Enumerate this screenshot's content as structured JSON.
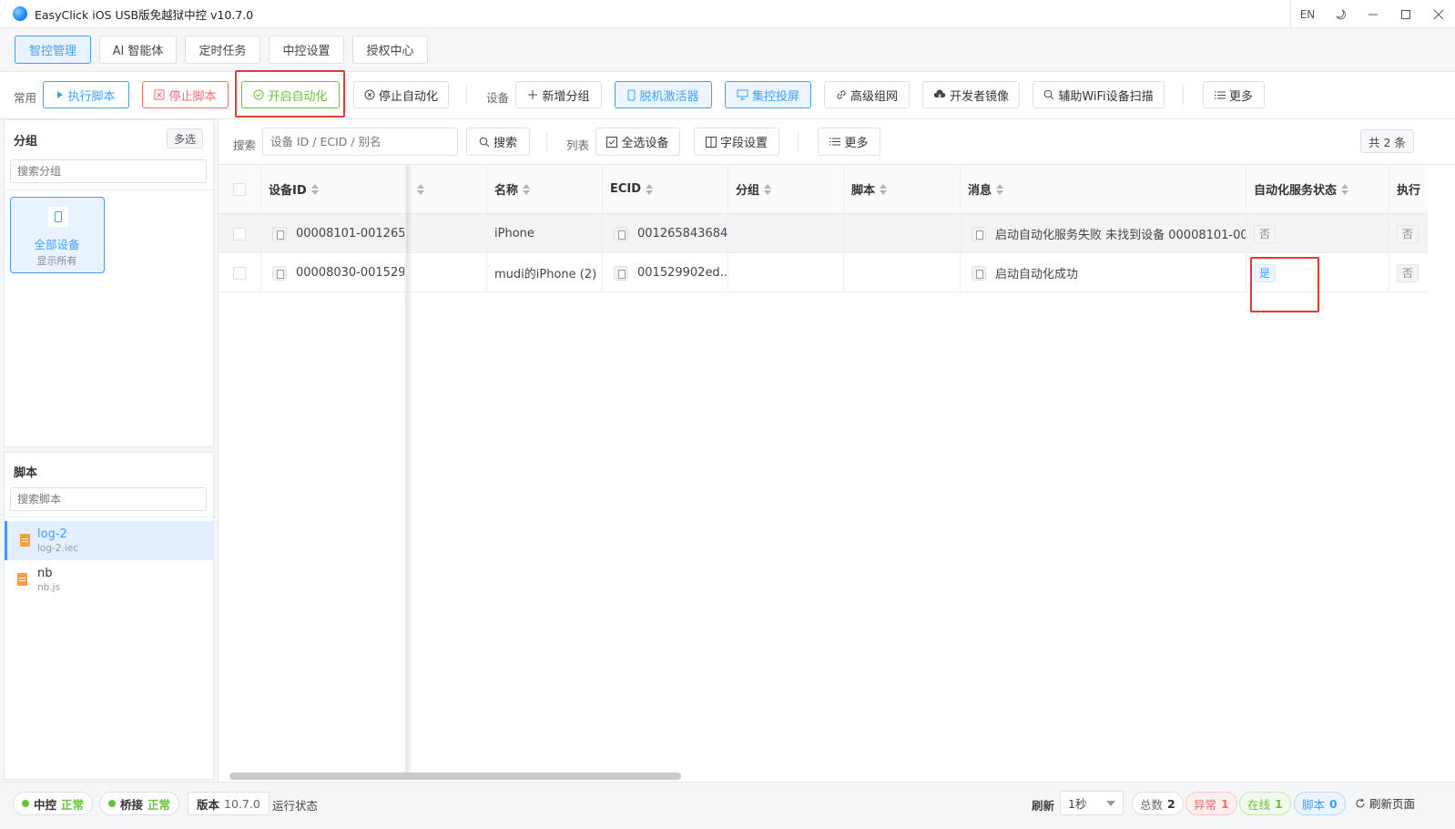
{
  "window": {
    "title": "EasyClick iOS USB版免越狱中控 v10.7.0",
    "lang_button": "EN"
  },
  "top_tabs": [
    {
      "label": "智控管理",
      "active": true
    },
    {
      "label": "AI 智能体",
      "active": false
    },
    {
      "label": "定时任务",
      "active": false
    },
    {
      "label": "中控设置",
      "active": false
    },
    {
      "label": "授权中心",
      "active": false
    }
  ],
  "toolbar": {
    "common_label": "常用",
    "run_script": "执行脚本",
    "stop_script": "停止脚本",
    "start_automation": "开启自动化",
    "stop_automation": "停止自动化",
    "device_label": "设备",
    "add_group": "新增分组",
    "offline_activator": "脱机激活器",
    "group_screen": "集控投屏",
    "advanced_network": "高级组网",
    "developer_image": "开发者镜像",
    "wifi_scan": "辅助WiFi设备扫描",
    "more": "更多"
  },
  "groups_panel": {
    "title": "分组",
    "multi_select": "多选",
    "search_placeholder": "搜索分组",
    "all_devices_label": "全部设备",
    "all_devices_sub": "显示所有"
  },
  "scripts_panel": {
    "title": "脚本",
    "search_placeholder": "搜索脚本",
    "items": [
      {
        "name": "log-2",
        "file": "log-2.iec",
        "active": true
      },
      {
        "name": "nb",
        "file": "nb.js",
        "active": false
      }
    ]
  },
  "main_bar": {
    "search_label": "搜索",
    "search_placeholder": "设备 ID / ECID / 别名",
    "search_button": "搜索",
    "list_label": "列表",
    "select_all": "全选设备",
    "field_settings": "字段设置",
    "more": "更多",
    "total": "共 2 条"
  },
  "table": {
    "columns": [
      "设备ID",
      "名称",
      "ECID",
      "分组",
      "脚本",
      "消息",
      "自动化服务状态",
      "执行"
    ],
    "rows": [
      {
        "device_id": "00008101-001265...",
        "name": "iPhone",
        "ecid": "001265843684...",
        "group": "",
        "script": "",
        "message": "启动自动化服务失败 未找到设备 00008101-00...",
        "automation_status": "否",
        "exec": "否"
      },
      {
        "device_id": "00008030-001529...",
        "name": "mudi的iPhone (2)",
        "ecid": "001529902ed...",
        "group": "",
        "script": "",
        "message": "启动自动化成功",
        "automation_status": "是",
        "exec": "否"
      }
    ]
  },
  "statusbar": {
    "center_label": "中控",
    "center_status": "正常",
    "bridge_label": "桥接",
    "bridge_status": "正常",
    "version_label": "版本",
    "version_value": "10.7.0",
    "run_status": "运行状态",
    "refresh_label": "刷新",
    "refresh_value": "1秒",
    "total_label": "总数",
    "total_value": "2",
    "error_label": "异常",
    "error_value": "1",
    "online_label": "在线",
    "online_value": "1",
    "script_label": "脚本",
    "script_value": "0",
    "refresh_page": "刷新页面"
  },
  "colors": {
    "accent": "#409eff",
    "danger": "#f56c6c",
    "success": "#67c23a",
    "highlight_box": "#e53935"
  }
}
